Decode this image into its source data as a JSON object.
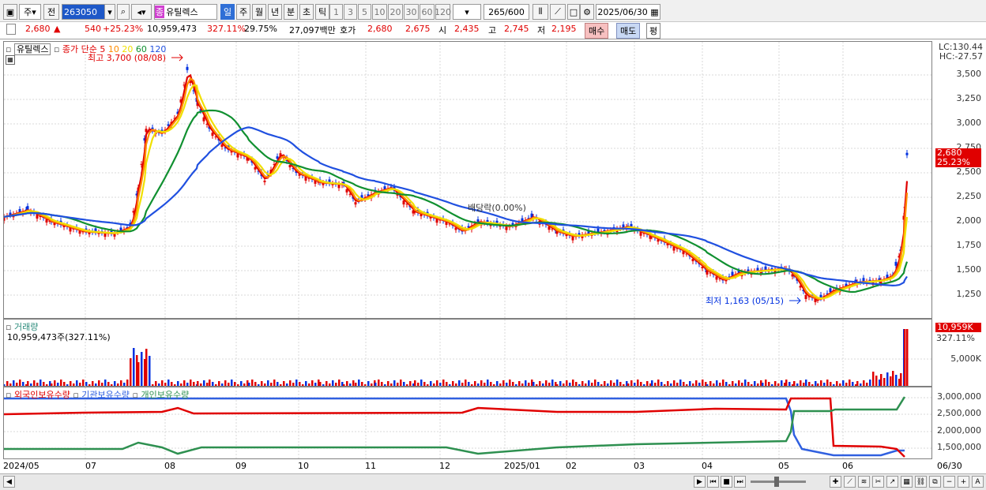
{
  "toolbar": {
    "type_label": "주",
    "prev_label": "전",
    "stock_code": "263050",
    "stock_name": "유틸렉스",
    "stock_badge": "종",
    "periods": [
      "일",
      "주",
      "월",
      "년",
      "분",
      "초",
      "틱"
    ],
    "active_period": "일",
    "intervals": [
      "1",
      "3",
      "5",
      "10",
      "20",
      "30",
      "60",
      "120"
    ],
    "bar_count": "265",
    "bar_total": "/600",
    "date": "2025/06/30"
  },
  "quote": {
    "price": "2,680",
    "change_arrow": "▲",
    "change": "540",
    "change_pct": "+25.23%",
    "volume": "10,959,473",
    "volume_ratio": "327.11%",
    "turnover_rate": "29.75%",
    "amount": "27,097백만",
    "ask_label": "호가",
    "ask": "2,680",
    "bid": "2,675",
    "open_label": "시",
    "open": "2,435",
    "high_label": "고",
    "high": "2,745",
    "low_label": "저",
    "low": "2,195",
    "buy_label": "매수",
    "sell_label": "매도",
    "avg_label": "평"
  },
  "price_panel": {
    "title": "유틸렉스",
    "ma_label": "종가 단순",
    "ma_periods": [
      "5",
      "10",
      "20",
      "60",
      "120"
    ],
    "ma_colors": [
      "#e00000",
      "#ff8c00",
      "#f0e000",
      "#109030",
      "#2050e0"
    ],
    "high_note": "최고 3,700 (08/08)",
    "low_note": "최저 1,163 (05/15)",
    "dividend_note": "배당락(0.00%)",
    "lc": "LC:130.44",
    "hc": "HC:-27.57",
    "y_ticks": [
      "3,500",
      "3,250",
      "3,000",
      "2,750",
      "2,500",
      "2,250",
      "2,000",
      "1,750",
      "1,500",
      "1,250"
    ],
    "current_price": "2,680",
    "current_pct": "25.23%"
  },
  "volume_panel": {
    "title": "거래량",
    "value_line": "10,959,473주(327.11%)",
    "y_ticks": [
      "5,000K"
    ],
    "current": "10,959K",
    "current_pct": "327.11%"
  },
  "holding_panel": {
    "legend": [
      "외국인보유수량",
      "기관보유수량",
      "개인보유수량"
    ],
    "colors": [
      "#e00000",
      "#3060e0",
      "#2e9050"
    ],
    "y_ticks": [
      "3,000,000",
      "2,500,000",
      "2,000,000",
      "1,500,000"
    ]
  },
  "x_axis": [
    "2024/05",
    "07",
    "08",
    "09",
    "10",
    "11",
    "12",
    "2025/01",
    "02",
    "03",
    "04",
    "05",
    "06",
    "06/30"
  ]
}
